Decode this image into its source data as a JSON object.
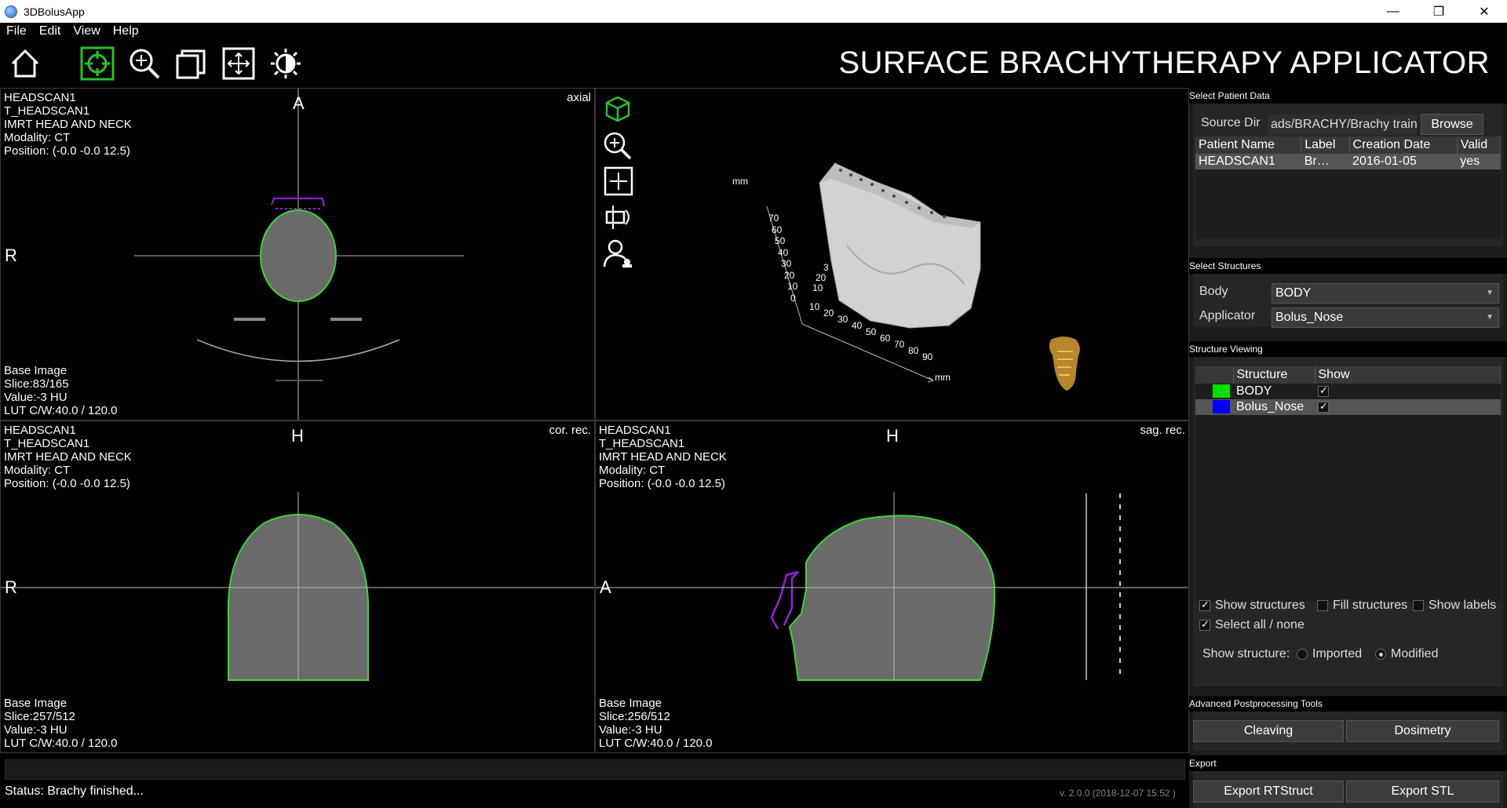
{
  "window": {
    "title": "3DBolusApp",
    "minimize": "—",
    "maximize": "❐",
    "close": "✕"
  },
  "menu": [
    "File",
    "Edit",
    "View",
    "Help"
  ],
  "toolbar": {
    "heading": "SURFACE BRACHYTHERAPY APPLICATOR",
    "icons": [
      "home-icon",
      "crosshair-target-icon",
      "zoom-icon",
      "layers-icon",
      "pan-icon",
      "contrast-icon"
    ]
  },
  "views": {
    "axial": {
      "info": [
        "HEADSCAN1",
        "T_HEADSCAN1",
        "IMRT HEAD AND NECK",
        "Modality: CT",
        "Position: (-0.0 -0.0 12.5)"
      ],
      "tag": "axial",
      "orient_top": "A",
      "orient_left": "R",
      "bottom": [
        "Base Image",
        "Slice:83/165",
        "Value:-3 HU",
        "LUT C/W:40.0 / 120.0"
      ]
    },
    "render3d": {
      "axis_unit_top": "mm",
      "axis_unit_bottom": "mm",
      "ticks_vertical": [
        "70",
        "60",
        "50",
        "40",
        "30",
        "20",
        "10",
        "0"
      ],
      "ticks_mid": [
        "3",
        "20",
        "10"
      ],
      "ticks_horizontal": [
        "10",
        "20",
        "30",
        "40",
        "50",
        "60",
        "70",
        "80",
        "90"
      ],
      "tools": [
        "3d-cube-icon",
        "zoom-icon",
        "pan-icon",
        "rotate-icon",
        "person-icon"
      ]
    },
    "coronal": {
      "info": [
        "HEADSCAN1",
        "T_HEADSCAN1",
        "IMRT HEAD AND NECK",
        "Modality: CT",
        "Position: (-0.0 -0.0 12.5)"
      ],
      "tag": "cor. rec.",
      "orient_top": "H",
      "orient_left": "R",
      "bottom": [
        "Base Image",
        "Slice:257/512",
        "Value:-3 HU",
        "LUT C/W:40.0 / 120.0"
      ]
    },
    "sagittal": {
      "info": [
        "HEADSCAN1",
        "T_HEADSCAN1",
        "IMRT HEAD AND NECK",
        "Modality: CT",
        "Position: (-0.0 -0.0 12.5)"
      ],
      "tag": "sag. rec.",
      "orient_top": "H",
      "orient_left": "A",
      "bottom": [
        "Base Image",
        "Slice:256/512",
        "Value:-3 HU",
        "LUT C/W:40.0 / 120.0"
      ]
    }
  },
  "status": {
    "text": "Status: Brachy finished...",
    "version": "v. 2.0.0 (2018-12-07 15:52 )"
  },
  "panel": {
    "patient": {
      "title": "Select Patient Data",
      "source_label": "Source Dir",
      "source_value": "ads/BRACHY/Brachy training",
      "browse": "Browse",
      "columns": [
        "Patient Name",
        "Label",
        "Creation Date",
        "Valid"
      ],
      "rows": [
        [
          "HEADSCAN1",
          "Br…",
          "2016-01-05",
          "yes"
        ]
      ]
    },
    "structures": {
      "title": "Select Structures",
      "body_label": "Body",
      "body_value": "BODY",
      "applicator_label": "Applicator",
      "applicator_value": "Bolus_Nose"
    },
    "viewing": {
      "title": "Structure Viewing",
      "columns": [
        "Structure",
        "Show"
      ],
      "rows": [
        {
          "name": "BODY",
          "color": "#00e000",
          "show": true
        },
        {
          "name": "Bolus_Nose",
          "color": "#0000ff",
          "show": true
        }
      ],
      "show_structures": "Show structures",
      "fill_structures": "Fill structures",
      "show_labels": "Show labels",
      "select_all": "Select all / none",
      "show_structure": "Show structure:",
      "imported": "Imported",
      "modified": "Modified"
    },
    "advanced": {
      "title": "Advanced Postprocessing Tools",
      "cleaving": "Cleaving",
      "dosimetry": "Dosimetry"
    },
    "export": {
      "title": "Export",
      "rtstruct": "Export RTStruct",
      "stl": "Export STL"
    }
  },
  "colors": {
    "body_contour": "#3ad63a",
    "applicator_contour": "#9b1fe0",
    "panel_bg": "#1c1c1c"
  }
}
